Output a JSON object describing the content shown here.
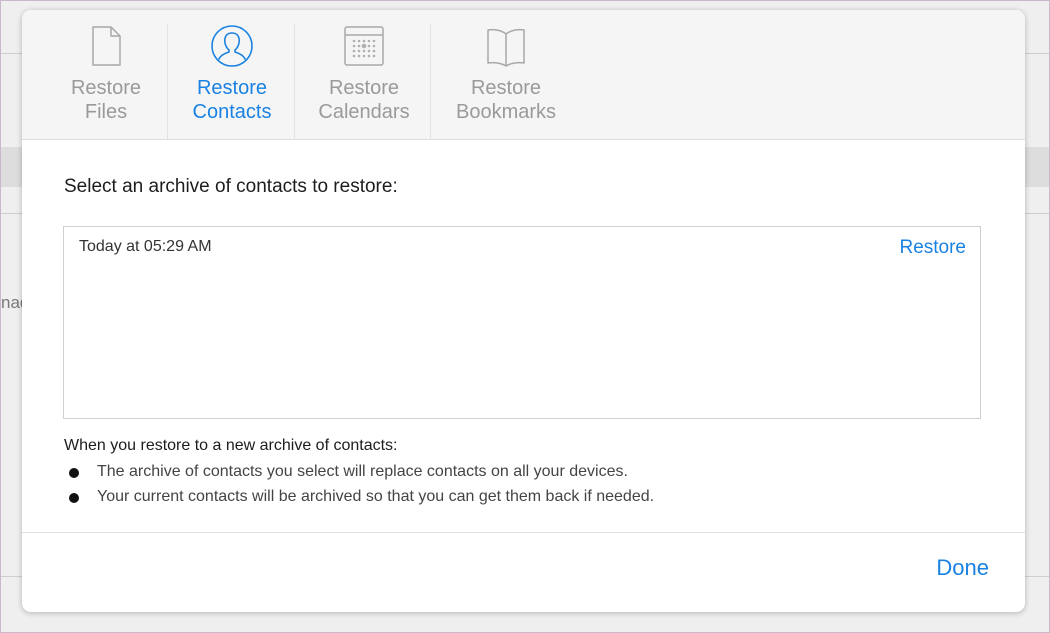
{
  "tabs": [
    {
      "line1": "Restore",
      "line2": "Files",
      "icon": "file-icon",
      "active": false
    },
    {
      "line1": "Restore",
      "line2": "Contacts",
      "icon": "contacts-icon",
      "active": true
    },
    {
      "line1": "Restore",
      "line2": "Calendars",
      "icon": "calendar-icon",
      "active": false
    },
    {
      "line1": "Restore",
      "line2": "Bookmarks",
      "icon": "bookmarks-icon",
      "active": false
    }
  ],
  "content": {
    "title": "Select an archive of contacts to restore:",
    "archives": [
      {
        "date": "Today at 05:29 AM",
        "action": "Restore"
      }
    ],
    "note_heading": "When you restore to a new archive of contacts:",
    "bullets": [
      "The archive of contacts you select will replace contacts on all your devices.",
      "Your current contacts will be archived so that you can get them back if needed."
    ]
  },
  "background": {
    "partial_text": "nad"
  },
  "footer": {
    "done_label": "Done"
  },
  "colors": {
    "accent": "#1a82e2",
    "inactive_tab": "#9a9a9a"
  }
}
